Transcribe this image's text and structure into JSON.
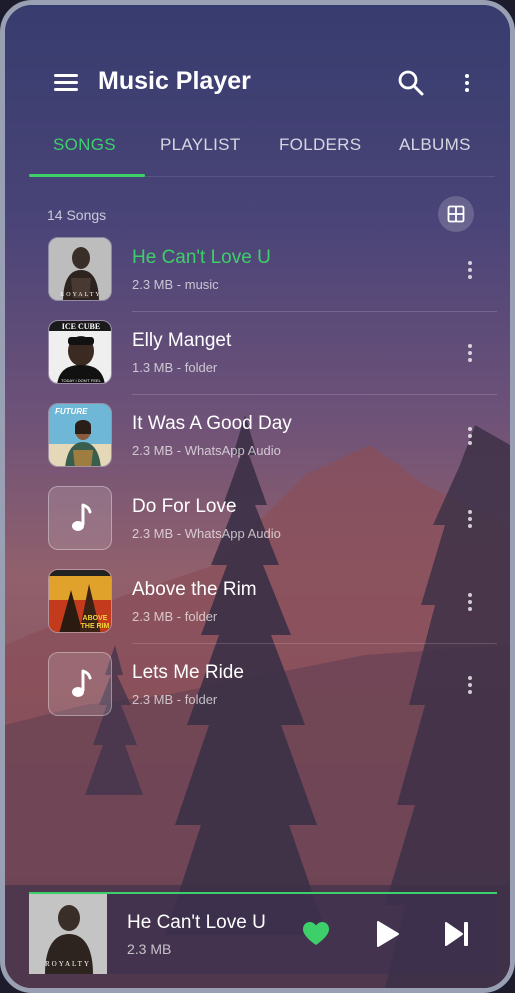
{
  "app": {
    "title": "Music Player"
  },
  "tabs": [
    {
      "label": "SONGS",
      "active": true
    },
    {
      "label": "PLAYLIST",
      "active": false
    },
    {
      "label": "FOLDERS",
      "active": false
    },
    {
      "label": "ALBUMS",
      "active": false
    }
  ],
  "library": {
    "count_label": "14 Songs"
  },
  "songs": [
    {
      "title": "He Can't Love U",
      "meta": "2.3 MB - music",
      "playing": true,
      "art": "royalty-album-art"
    },
    {
      "title": "Elly Manget",
      "meta": "1.3 MB - folder",
      "playing": false,
      "art": "ice-cube-album-art"
    },
    {
      "title": "It Was A Good Day",
      "meta": "2.3 MB - WhatsApp Audio",
      "playing": false,
      "art": "future-album-art"
    },
    {
      "title": "Do For Love",
      "meta": "2.3 MB - WhatsApp Audio",
      "playing": false,
      "art": "music-note-icon"
    },
    {
      "title": "Above the Rim",
      "meta": "2.3 MB - folder",
      "playing": false,
      "art": "above-the-rim-album-art"
    },
    {
      "title": "Lets Me Ride",
      "meta": "2.3 MB - folder",
      "playing": false,
      "art": "music-note-icon"
    }
  ],
  "now_playing": {
    "title": "He Can't Love U",
    "meta": "2.3 MB",
    "liked": true
  },
  "colors": {
    "accent": "#3dd06a",
    "text": "#ffffff"
  },
  "icons": [
    "menu-icon",
    "search-icon",
    "more-vert-icon",
    "grid-view-icon",
    "music-note-icon",
    "heart-icon",
    "play-icon",
    "skip-next-icon"
  ]
}
